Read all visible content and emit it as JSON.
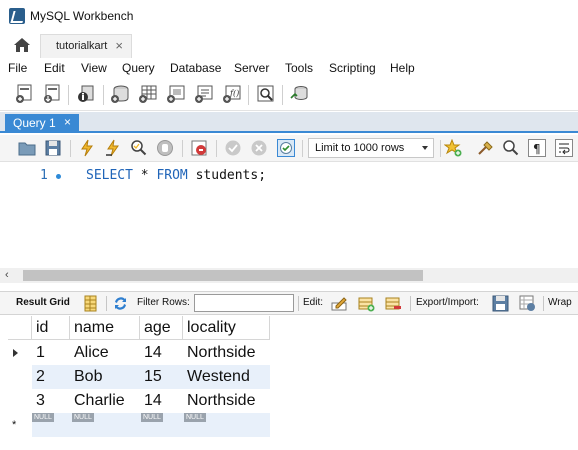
{
  "window": {
    "title": "MySQL Workbench"
  },
  "connection_tab": {
    "label": "tutorialkart",
    "close": "×"
  },
  "menu": [
    "File",
    "Edit",
    "View",
    "Query",
    "Database",
    "Server",
    "Tools",
    "Scripting",
    "Help"
  ],
  "query_tab": {
    "label": "Query 1",
    "close": "×"
  },
  "sql_toolbar": {
    "limit_label": "Limit to 1000 rows"
  },
  "editor": {
    "line_number": "1",
    "kw_select": "SELECT",
    "rest1": " * ",
    "kw_from": "FROM",
    "rest2": " students;"
  },
  "result_toolbar": {
    "result_grid": "Result Grid",
    "filter_rows": "Filter Rows:",
    "edit": "Edit:",
    "export_import": "Export/Import:",
    "wrap": "Wrap"
  },
  "grid": {
    "columns": [
      "id",
      "name",
      "age",
      "locality"
    ],
    "rows": [
      [
        "1",
        "Alice",
        "14",
        "Northside"
      ],
      [
        "2",
        "Bob",
        "15",
        "Westend"
      ],
      [
        "3",
        "Charlie",
        "14",
        "Northside"
      ]
    ],
    "null_label": "NULL",
    "new_row_marker": "*"
  },
  "colors": {
    "accent": "#3a89d4",
    "keyword": "#1f64b8",
    "alt_row": "#e8f0fa"
  }
}
